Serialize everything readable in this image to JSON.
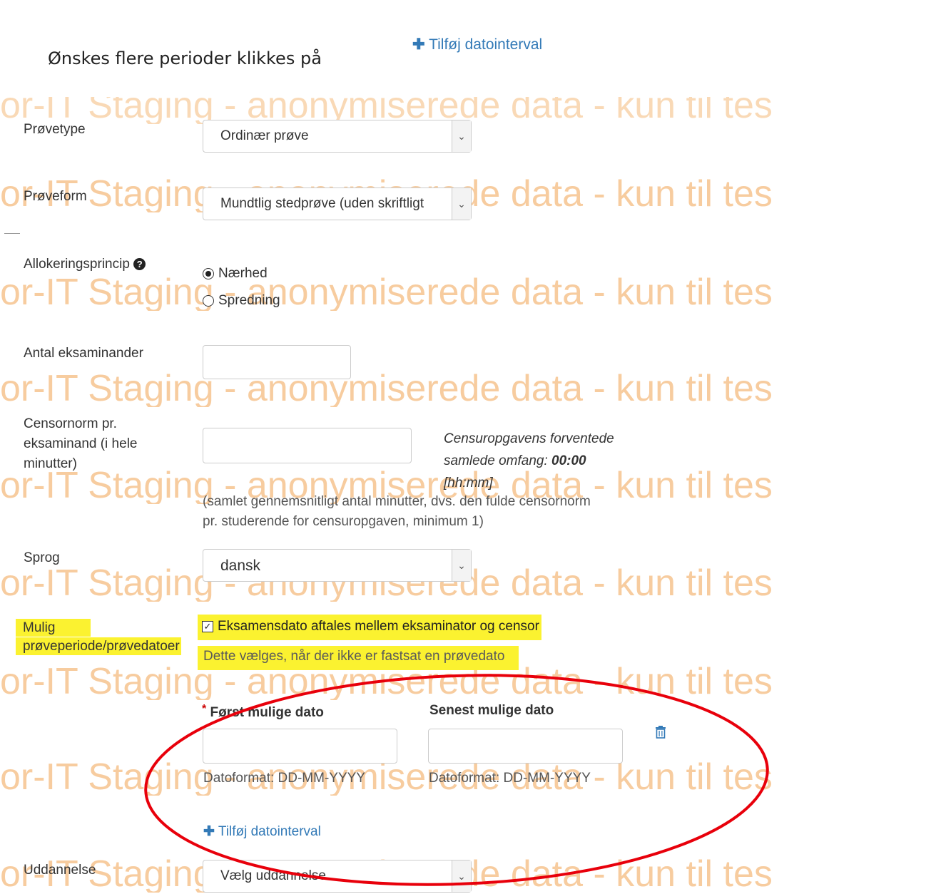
{
  "instruction": {
    "text": "Ønskes flere perioder klikkes på",
    "link_label": "Tilføj datointerval"
  },
  "watermark": {
    "top": "or-IT Staging - anonymiserede data - kun til tes",
    "line": "or-IT Staging - anonymiserede data - kun til tes"
  },
  "form": {
    "provetype": {
      "label": "Prøvetype",
      "value": "Ordinær prøve"
    },
    "proveform": {
      "label": "Prøveform",
      "value": "Mundtlig stedprøve (uden skriftligt"
    },
    "allokering": {
      "label": "Allokeringsprincip",
      "options": [
        "Nærhed",
        "Spredning"
      ],
      "selected": "Nærhed"
    },
    "antal": {
      "label": "Antal eksaminander",
      "value": ""
    },
    "censornorm": {
      "label_lines": [
        "Censornorm pr.",
        "eksaminand (i hele",
        "minutter)"
      ],
      "info_line1": "Censuropgavens forventede",
      "info_line2_prefix": "samlede omfang: ",
      "info_value": "00:00",
      "info_line3": "[hh:mm]",
      "help_line1": "(samlet gennemsnitligt antal minutter, dvs. den fulde censornorm",
      "help_line2": "pr. studerende for censuropgaven, minimum 1)"
    },
    "sprog": {
      "label": "Sprog",
      "value": "dansk"
    },
    "periode": {
      "label_line1": "Mulig",
      "label_line2": "prøveperiode/prøvedatoer",
      "checkbox_label": "Eksamensdato aftales mellem eksaminator og censor",
      "checkbox_checked": true,
      "hint": "Dette vælges, når der ikke er fastsat en prøvedato",
      "required_mark": "*",
      "first_label": "Først mulige dato",
      "last_label": "Senest mulige dato",
      "first_format": "Datoformat: DD-MM-YYYY",
      "last_format": "Datoformat: DD-MM-YYYY",
      "add_interval": "Tilføj datointerval"
    },
    "uddannelse": {
      "label": "Uddannelse",
      "value": "Vælg uddannelse"
    }
  },
  "colors": {
    "link": "#337ab7",
    "highlight": "#fbf230",
    "annotation": "#e8000b",
    "watermark": "#f6c48f"
  }
}
